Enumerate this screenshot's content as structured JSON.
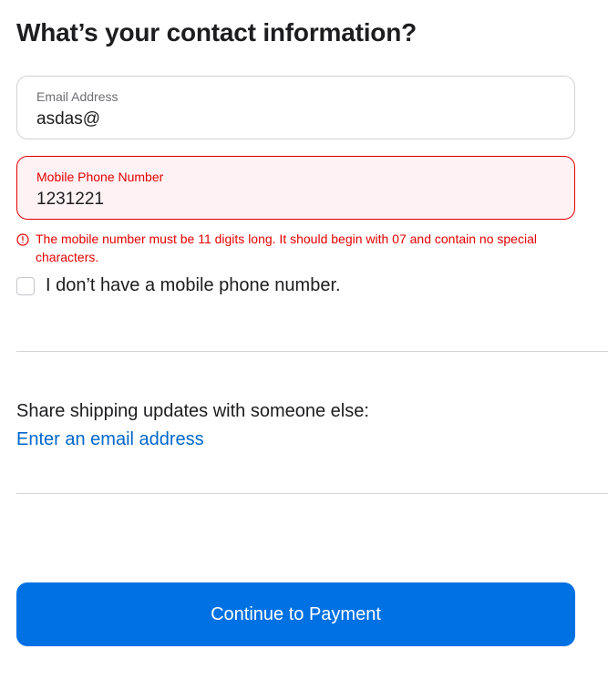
{
  "heading": "What’s your contact information?",
  "email_field": {
    "label": "Email Address",
    "value": "asdas@"
  },
  "phone_field": {
    "label": "Mobile Phone Number",
    "value": "1231221",
    "state": "error"
  },
  "error": {
    "icon": "error-circle-icon",
    "message": "The mobile number must be 11 digits long. It should begin with 07 and contain no special characters."
  },
  "no_phone_checkbox": {
    "label": "I don’t have a mobile phone number.",
    "checked": false
  },
  "share": {
    "label": "Share shipping updates with someone else:",
    "link": "Enter an email address"
  },
  "continue_button": {
    "label": "Continue to Payment"
  },
  "colors": {
    "accent": "#0071e3",
    "link": "#0066cc",
    "error": "#e30000",
    "error_background": "#fff2f4"
  }
}
